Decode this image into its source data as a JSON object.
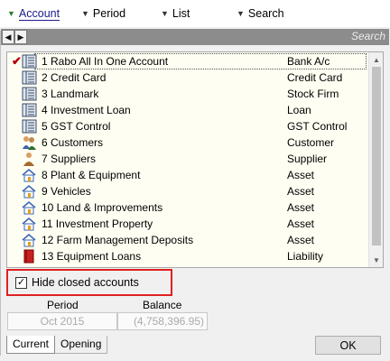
{
  "menu": {
    "items": [
      {
        "label": "Account",
        "icon": "triangle-down-icon",
        "active": true
      },
      {
        "label": "Period",
        "icon": "triangle-down-icon"
      },
      {
        "label": "List",
        "icon": "triangle-down-icon"
      },
      {
        "label": "Search",
        "icon": "triangle-down-icon"
      }
    ]
  },
  "nav": {
    "prev_glyph": "◀",
    "next_glyph": "▶",
    "search_hint": "Search"
  },
  "accounts": [
    {
      "num": "1",
      "name": "Rabo All In One Account",
      "type": "Bank A/c",
      "icon": "ledger-icon",
      "checked": true,
      "selected": true
    },
    {
      "num": "2",
      "name": "Credit Card",
      "type": "Credit Card",
      "icon": "ledger-icon"
    },
    {
      "num": "3",
      "name": "Landmark",
      "type": "Stock Firm",
      "icon": "ledger-icon"
    },
    {
      "num": "4",
      "name": "Investment Loan",
      "type": "Loan",
      "icon": "ledger-icon"
    },
    {
      "num": "5",
      "name": "GST Control",
      "type": "GST Control",
      "icon": "ledger-icon"
    },
    {
      "num": "6",
      "name": "Customers",
      "type": "Customer",
      "icon": "people-icon"
    },
    {
      "num": "7",
      "name": "Suppliers",
      "type": "Supplier",
      "icon": "person-icon"
    },
    {
      "num": "8",
      "name": "Plant & Equipment",
      "type": "Asset",
      "icon": "house-icon"
    },
    {
      "num": "9",
      "name": "Vehicles",
      "type": "Asset",
      "icon": "house-icon"
    },
    {
      "num": "10",
      "name": "Land & Improvements",
      "type": "Asset",
      "icon": "house-icon"
    },
    {
      "num": "11",
      "name": "Investment Property",
      "type": "Asset",
      "icon": "house-icon"
    },
    {
      "num": "12",
      "name": "Farm Management Deposits",
      "type": "Asset",
      "icon": "house-icon"
    },
    {
      "num": "13",
      "name": "Equipment Loans",
      "type": "Liability",
      "icon": "red-book-icon"
    }
  ],
  "hide_closed": {
    "label": "Hide closed accounts",
    "checked": true
  },
  "period": {
    "header": "Period",
    "value": "Oct 2015"
  },
  "balance": {
    "header": "Balance",
    "value": "(4,758,396.95)"
  },
  "tabs": [
    {
      "label": "Current",
      "active": true
    },
    {
      "label": "Opening"
    }
  ],
  "ok_label": "OK",
  "colors": {
    "list_bg": "#fffef2",
    "highlight": "#e02020",
    "nav_strip": "#8c8c8c",
    "check": "#b00000"
  }
}
